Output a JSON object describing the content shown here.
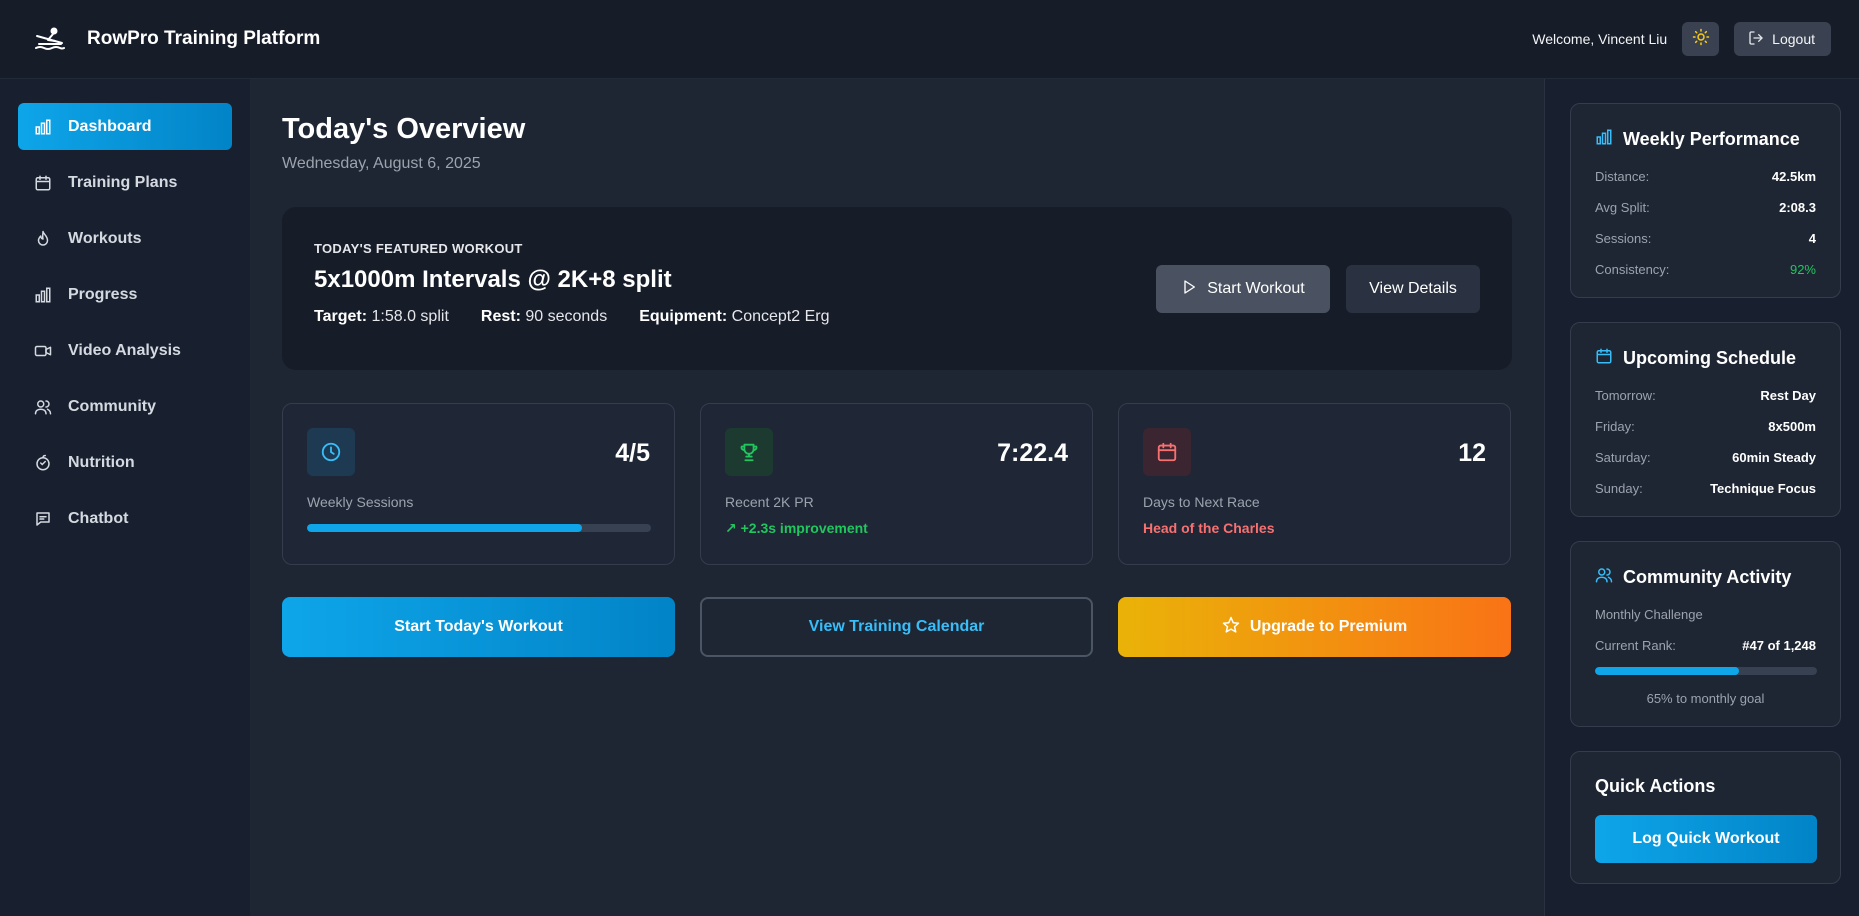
{
  "header": {
    "title": "RowPro Training Platform",
    "logo_icon": "rowing-icon",
    "welcome": "Welcome, Vincent Liu",
    "theme_icon": "sun-icon",
    "logout_label": "Logout"
  },
  "sidebar": {
    "items": [
      {
        "label": "Dashboard",
        "icon": "bar-chart-icon",
        "active": true
      },
      {
        "label": "Training Plans",
        "icon": "calendar-icon"
      },
      {
        "label": "Workouts",
        "icon": "flame-icon"
      },
      {
        "label": "Progress",
        "icon": "bar-chart-icon"
      },
      {
        "label": "Video Analysis",
        "icon": "video-icon"
      },
      {
        "label": "Community",
        "icon": "users-icon"
      },
      {
        "label": "Nutrition",
        "icon": "apple-icon"
      },
      {
        "label": "Chatbot",
        "icon": "chat-icon"
      }
    ]
  },
  "main": {
    "title": "Today's Overview",
    "date": "Wednesday, August 6, 2025",
    "featured": {
      "kicker": "TODAY'S FEATURED WORKOUT",
      "title": "5x1000m Intervals @ 2K+8 split",
      "target_label": "Target:",
      "target_value": "1:58.0 split",
      "rest_label": "Rest:",
      "rest_value": "90 seconds",
      "equipment_label": "Equipment:",
      "equipment_value": "Concept2 Erg",
      "start_label": "Start Workout",
      "details_label": "View Details"
    },
    "stats": [
      {
        "value": "4/5",
        "label": "Weekly Sessions",
        "icon": "clock-icon",
        "progress": 0.8
      },
      {
        "value": "7:22.4",
        "label": "Recent 2K PR",
        "icon": "trophy-icon",
        "sub": "↗ +2.3s improvement",
        "sub_color": "#22c55e"
      },
      {
        "value": "12",
        "label": "Days to Next Race",
        "icon": "calendar-icon",
        "sub": "Head of the Charles",
        "sub_color": "#f87171"
      }
    ],
    "actions": {
      "start_today": "Start Today's Workout",
      "calendar": "View Training Calendar",
      "premium": "Upgrade to Premium"
    }
  },
  "right": {
    "weekly": {
      "title": "Weekly Performance",
      "rows": [
        {
          "k": "Distance:",
          "v": "42.5km"
        },
        {
          "k": "Avg Split:",
          "v": "2:08.3"
        },
        {
          "k": "Sessions:",
          "v": "4"
        },
        {
          "k": "Consistency:",
          "v": "92%"
        }
      ]
    },
    "schedule": {
      "title": "Upcoming Schedule",
      "rows": [
        {
          "k": "Tomorrow:",
          "v": "Rest Day"
        },
        {
          "k": "Friday:",
          "v": "8x500m"
        },
        {
          "k": "Saturday:",
          "v": "60min Steady"
        },
        {
          "k": "Sunday:",
          "v": "Technique Focus"
        }
      ]
    },
    "community": {
      "title": "Community Activity",
      "subtitle": "Monthly Challenge",
      "rank_label": "Current Rank:",
      "rank_value": "#47 of 1,248",
      "progress": 0.65,
      "note": "65% to monthly goal"
    },
    "quick": {
      "title": "Quick Actions",
      "button": "Log Quick Workout"
    }
  },
  "colors": {
    "accent": "#0ea5e9",
    "success": "#22c55e",
    "danger": "#f87171",
    "premium_start": "#eab308",
    "premium_end": "#f97316"
  }
}
